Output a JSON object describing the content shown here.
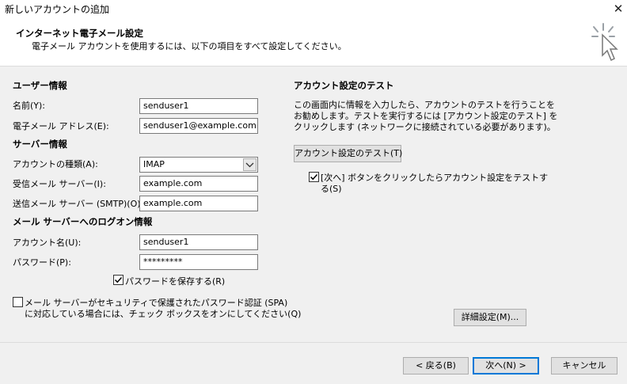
{
  "window": {
    "title": "新しいアカウントの追加",
    "close_glyph": "✕"
  },
  "header": {
    "title": "インターネット電子メール設定",
    "subtitle": "電子メール アカウントを使用するには、以下の項目をすべて設定してください。"
  },
  "user_info": {
    "section_title": "ユーザー情報",
    "name_label": "名前(Y):",
    "name_value": "senduser1",
    "email_label": "電子メール アドレス(E):",
    "email_value": "senduser1@example.com"
  },
  "server_info": {
    "section_title": "サーバー情報",
    "account_type_label": "アカウントの種類(A):",
    "account_type_value": "IMAP",
    "incoming_label": "受信メール サーバー(I):",
    "incoming_value": "example.com",
    "outgoing_label": "送信メール サーバー (SMTP)(O):",
    "outgoing_value": "example.com"
  },
  "logon_info": {
    "section_title": "メール サーバーへのログオン情報",
    "account_name_label": "アカウント名(U):",
    "account_name_value": "senduser1",
    "password_label": "パスワード(P):",
    "password_value": "*********",
    "remember_password_label": "パスワードを保存する(R)",
    "remember_password_checked": true,
    "spa_label_line1": "メール サーバーがセキュリティで保護されたパスワード認証 (SPA)",
    "spa_label_line2": "に対応している場合には、チェック ボックスをオンにしてください(Q)",
    "spa_checked": false
  },
  "test_settings": {
    "section_title": "アカウント設定のテスト",
    "description_line1": "この画面内に情報を入力したら、アカウントのテストを行うことを",
    "description_line2": "お勧めします。テストを実行するには [アカウント設定のテスト] を",
    "description_line3": "クリックします (ネットワークに接続されている必要があります)。",
    "test_button_label": "アカウント設定のテスト(T)",
    "auto_test_label_line1": "[次へ] ボタンをクリックしたらアカウント設定をテストす",
    "auto_test_label_line2": "る(S)",
    "auto_test_checked": true,
    "more_settings_label": "詳細設定(M)..."
  },
  "footer": {
    "back_label": "< 戻る(B)",
    "next_label": "次へ(N) >",
    "cancel_label": "キャンセル"
  },
  "icons": {
    "wizard": "wizard-cursor-icon",
    "dropdown": "chevron-down-icon",
    "check": "checkmark-icon"
  }
}
